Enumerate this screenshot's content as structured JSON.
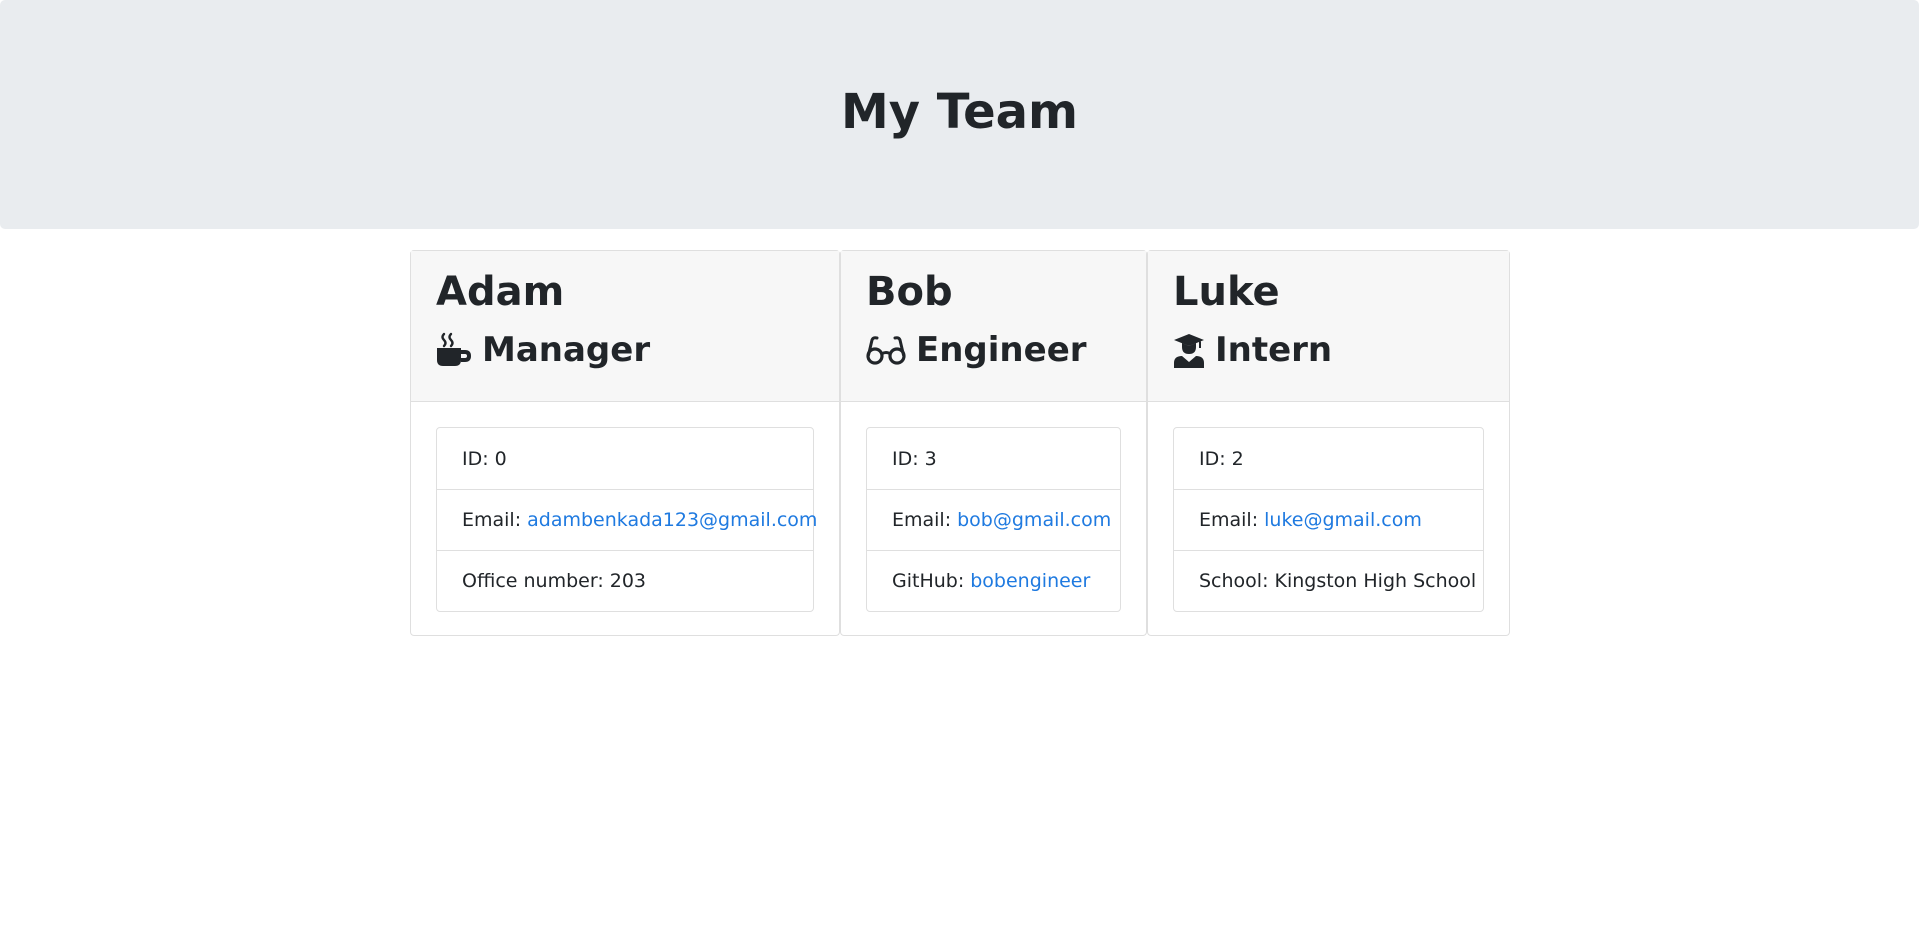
{
  "page": {
    "title": "My Team"
  },
  "members": [
    {
      "name": "Adam",
      "role": "Manager",
      "role_icon": "coffee-icon",
      "id_label": "ID:",
      "id": "0",
      "email_label": "Email:",
      "email": "adambenkada123@gmail.com",
      "extra_label": "Office number:",
      "extra": "203"
    },
    {
      "name": "Bob",
      "role": "Engineer",
      "role_icon": "glasses-icon",
      "id_label": "ID:",
      "id": "3",
      "email_label": "Email:",
      "email": "bob@gmail.com",
      "extra_label": "GitHub:",
      "extra": "bobengineer"
    },
    {
      "name": "Luke",
      "role": "Intern",
      "role_icon": "graduate-icon",
      "id_label": "ID:",
      "id": "2",
      "email_label": "Email:",
      "email": "luke@gmail.com",
      "extra_label": "School:",
      "extra": "Kingston High School"
    }
  ],
  "colors": {
    "header_bg": "#e9ecef",
    "card_header_bg": "#f7f7f7",
    "link": "#1f7ae0",
    "text": "#212529"
  }
}
